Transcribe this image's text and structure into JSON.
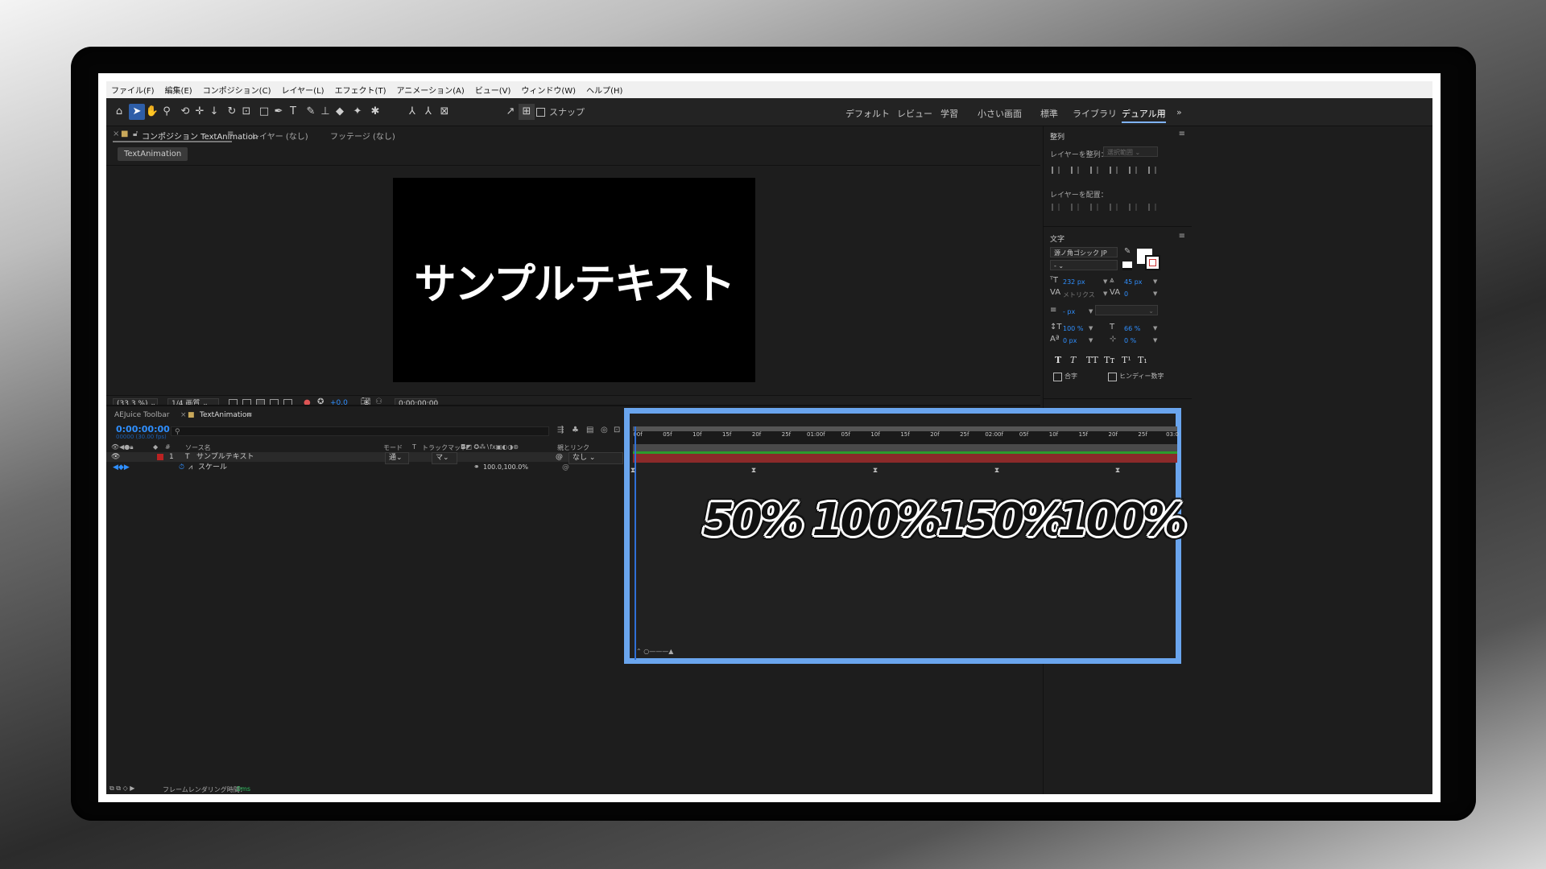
{
  "menu": [
    "ファイル(F)",
    "編集(E)",
    "コンポジション(C)",
    "レイヤー(L)",
    "エフェクト(T)",
    "アニメーション(A)",
    "ビュー(V)",
    "ウィンドウ(W)",
    "ヘルプ(H)"
  ],
  "toolbar": {
    "snap_label": "スナップ",
    "workspaces": [
      "デフォルト",
      "レビュー",
      "学習",
      "小さい画面",
      "標準",
      "ライブラリ",
      "デュアル用"
    ],
    "active_workspace": "デュアル用",
    "overflow": "»"
  },
  "comp_panel": {
    "tab_comp": "コンポジション TextAnimation",
    "tab_layer": "レイヤー (なし)",
    "tab_footage": "フッテージ (なし)",
    "breadcrumb": "TextAnimation",
    "canvas_text": "サンプルテキスト",
    "zoom": "(33.3 %)",
    "quality": "1/4 画質",
    "exposure": "+0.0",
    "timecode": "0:00:00:00"
  },
  "align_panel": {
    "title": "整列",
    "align_to_label": "レイヤーを整列：",
    "align_to_value": "選択範囲",
    "distribute_label": "レイヤーを配置："
  },
  "char_panel": {
    "title": "文字",
    "font": "源ノ角ゴシック JP",
    "style": "-",
    "font_size": "232 px",
    "leading": "45 px",
    "kerning": "メトリクス",
    "tracking": "0",
    "stroke_width": "- px",
    "vscale": "100 %",
    "hscale": "66 %",
    "baseline": "0 px",
    "tsume": "0 %",
    "style_buttons": [
      "T",
      "T",
      "TT",
      "Tт",
      "T¹",
      "T₁"
    ],
    "ligature": "合字",
    "hindi": "ヒンディー数字"
  },
  "timeline": {
    "tab_toolbar": "AEJuice Toolbar",
    "tab_comp": "TextAnimation",
    "timecode": "0:00:00:00",
    "frames": "00000 (30.00 fps)",
    "columns": {
      "num": "#",
      "source": "ソース名",
      "mode": "モード",
      "t": "T",
      "track": "トラックマット",
      "parent": "親とリンク"
    },
    "layer": {
      "index": "1",
      "name": "サンプルテキスト",
      "mode": "通",
      "track": "マ",
      "parent": "なし"
    },
    "property": {
      "name": "スケール",
      "value": "100.0,100.0%"
    },
    "status_label": "フレームレンダリング時間：",
    "status_value": "0ms",
    "ruler_ticks": [
      "00f",
      "05f",
      "10f",
      "15f",
      "20f",
      "25f",
      "01:00f",
      "05f",
      "10f",
      "15f",
      "20f",
      "25f",
      "02:00f",
      "05f",
      "10f",
      "15f",
      "20f",
      "25f",
      "03:0"
    ]
  },
  "annotations": [
    "50%",
    "100%",
    "150%",
    "100%"
  ],
  "colors": {
    "accent_blue": "#2f8fff",
    "highlight_border": "#6aa5ee",
    "layer_bar": "#8b2a2a",
    "label_red": "#b22222"
  }
}
